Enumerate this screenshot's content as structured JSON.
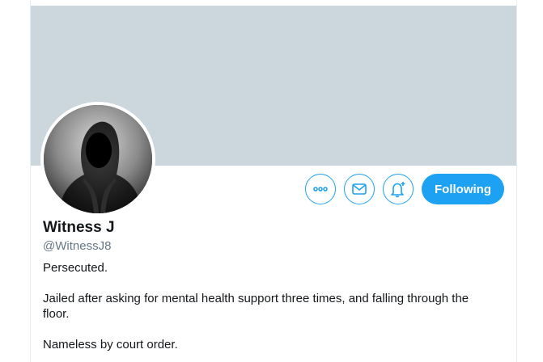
{
  "profile": {
    "display_name": "Witness J",
    "handle": "@WitnessJ8",
    "bio_lines": [
      "Persecuted.",
      "Jailed after asking for mental health support three times, and falling through the floor.",
      "Nameless by court order."
    ]
  },
  "actions": {
    "more_icon": "more-horizontal-icon",
    "message_icon": "envelope-icon",
    "notify_icon": "bell-plus-icon",
    "follow_label": "Following"
  },
  "colors": {
    "accent": "#1da1f2",
    "banner": "#ccd6dd",
    "text": "#14171a",
    "muted": "#657786"
  }
}
